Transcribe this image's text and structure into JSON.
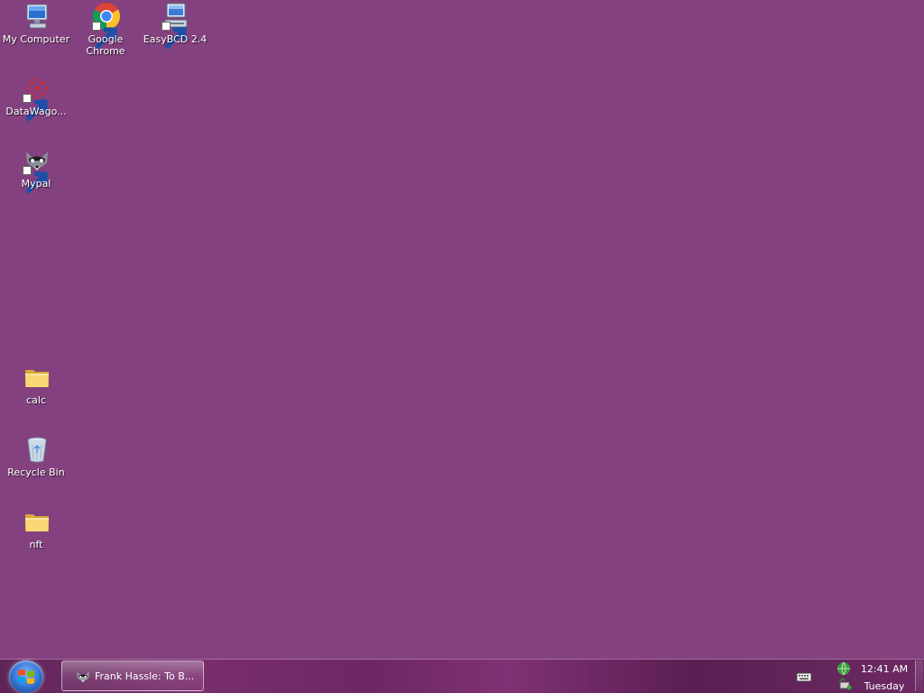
{
  "desktop": {
    "background_color": "#84417f",
    "icons": [
      {
        "label": "My Computer",
        "icon": "computer-icon"
      },
      {
        "label": "Google Chrome",
        "icon": "chrome-icon"
      },
      {
        "label": "EasyBCD 2.4",
        "icon": "easybcd-icon"
      },
      {
        "label": "DataWago...",
        "icon": "datawagon-icon"
      },
      {
        "label": "Mypal",
        "icon": "mypal-icon"
      },
      {
        "label": "calc",
        "icon": "folder-icon"
      },
      {
        "label": "Recycle Bin",
        "icon": "recycle-bin-icon"
      },
      {
        "label": "nft",
        "icon": "folder-icon"
      }
    ]
  },
  "taskbar": {
    "start_icon": "windows-logo-icon",
    "open_window": {
      "label": "Frank Hassle: To B...",
      "icon": "mypal-icon"
    },
    "tray": {
      "icons": [
        "keyboard-icon",
        "network-icon",
        "safely-remove-icon"
      ],
      "time": "12:41 AM",
      "day": "Tuesday"
    }
  }
}
